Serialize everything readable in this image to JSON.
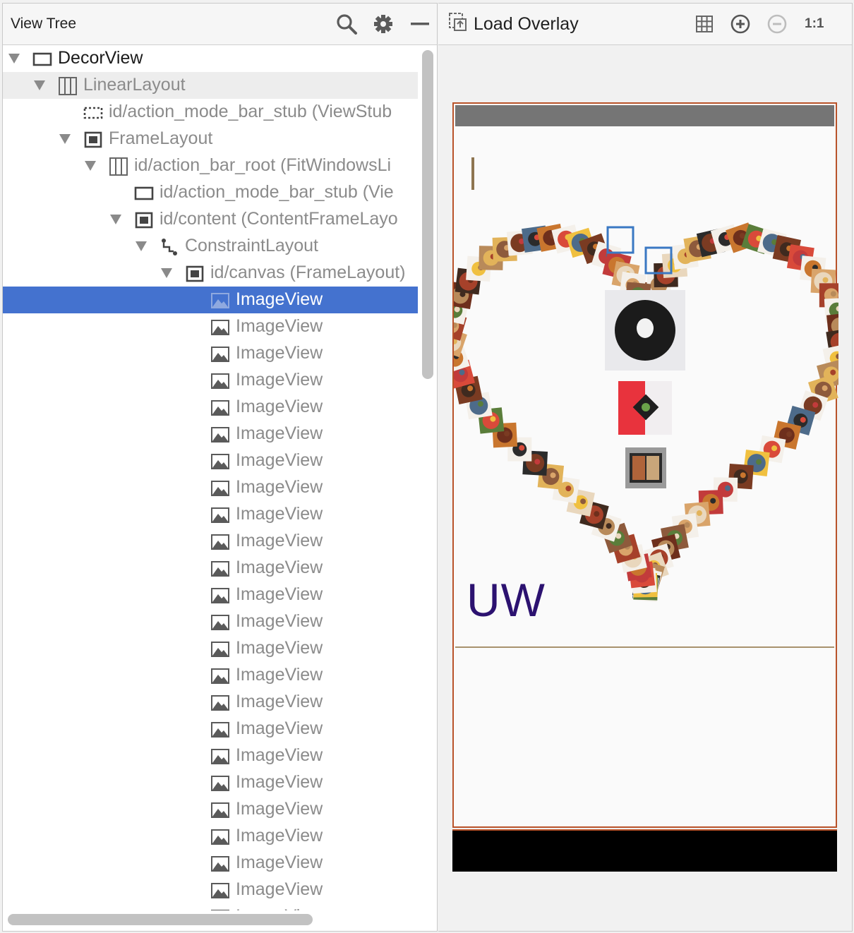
{
  "view_tree": {
    "title": "View Tree",
    "toolbar": [
      {
        "icon": "search-icon"
      },
      {
        "icon": "gear-icon"
      },
      {
        "icon": "minimize-icon"
      }
    ],
    "rows": [
      {
        "label": "DecorView",
        "depth": 0,
        "expanded": true,
        "icon": "frame-icon",
        "dark": true
      },
      {
        "label": "LinearLayout",
        "depth": 1,
        "expanded": true,
        "icon": "linear-layout-icon",
        "hover": true
      },
      {
        "label": "id/action_mode_bar_stub (ViewStub",
        "depth": 2,
        "icon": "viewstub-icon"
      },
      {
        "label": "FrameLayout",
        "depth": 2,
        "expanded": true,
        "icon": "framelayout-icon"
      },
      {
        "label": "id/action_bar_root (FitWindowsLi",
        "depth": 3,
        "expanded": true,
        "icon": "linear-layout-icon"
      },
      {
        "label": "id/action_mode_bar_stub (Vie",
        "depth": 4,
        "icon": "frame-icon"
      },
      {
        "label": "id/content (ContentFrameLayo",
        "depth": 4,
        "expanded": true,
        "icon": "framelayout-icon"
      },
      {
        "label": "ConstraintLayout",
        "depth": 5,
        "expanded": true,
        "icon": "constraint-layout-icon"
      },
      {
        "label": "id/canvas (FrameLayout)",
        "depth": 6,
        "expanded": true,
        "icon": "framelayout-icon"
      },
      {
        "label": "ImageView",
        "depth": 7,
        "icon": "image-icon",
        "selected": true
      },
      {
        "label": "ImageView",
        "depth": 7,
        "icon": "image-icon"
      },
      {
        "label": "ImageView",
        "depth": 7,
        "icon": "image-icon"
      },
      {
        "label": "ImageView",
        "depth": 7,
        "icon": "image-icon"
      },
      {
        "label": "ImageView",
        "depth": 7,
        "icon": "image-icon"
      },
      {
        "label": "ImageView",
        "depth": 7,
        "icon": "image-icon"
      },
      {
        "label": "ImageView",
        "depth": 7,
        "icon": "image-icon"
      },
      {
        "label": "ImageView",
        "depth": 7,
        "icon": "image-icon"
      },
      {
        "label": "ImageView",
        "depth": 7,
        "icon": "image-icon"
      },
      {
        "label": "ImageView",
        "depth": 7,
        "icon": "image-icon"
      },
      {
        "label": "ImageView",
        "depth": 7,
        "icon": "image-icon"
      },
      {
        "label": "ImageView",
        "depth": 7,
        "icon": "image-icon"
      },
      {
        "label": "ImageView",
        "depth": 7,
        "icon": "image-icon"
      },
      {
        "label": "ImageView",
        "depth": 7,
        "icon": "image-icon"
      },
      {
        "label": "ImageView",
        "depth": 7,
        "icon": "image-icon"
      },
      {
        "label": "ImageView",
        "depth": 7,
        "icon": "image-icon"
      },
      {
        "label": "ImageView",
        "depth": 7,
        "icon": "image-icon"
      },
      {
        "label": "ImageView",
        "depth": 7,
        "icon": "image-icon"
      },
      {
        "label": "ImageView",
        "depth": 7,
        "icon": "image-icon"
      },
      {
        "label": "ImageView",
        "depth": 7,
        "icon": "image-icon"
      },
      {
        "label": "ImageView",
        "depth": 7,
        "icon": "image-icon"
      },
      {
        "label": "ImageView",
        "depth": 7,
        "icon": "image-icon"
      },
      {
        "label": "ImageView",
        "depth": 7,
        "icon": "image-icon"
      },
      {
        "label": "ImageView",
        "depth": 7,
        "icon": "image-icon"
      }
    ]
  },
  "preview": {
    "load_overlay_label": "Load Overlay",
    "toolbar": [
      {
        "icon": "grid-icon"
      },
      {
        "icon": "zoom-in-icon"
      },
      {
        "icon": "zoom-out-icon"
      }
    ],
    "zoom_actual_label": "1:1",
    "device": {
      "screen_text": "UW",
      "heart_thumbnail_count": 90,
      "center_images": [
        "plate-image",
        "dish-red-image",
        "dish-box-image"
      ]
    }
  },
  "colors": {
    "selection": "#4472cf",
    "frame_border": "#b9532a",
    "uw_text": "#2c1270",
    "status_bar": "#757575",
    "highlight_box": "#3a78c3"
  }
}
